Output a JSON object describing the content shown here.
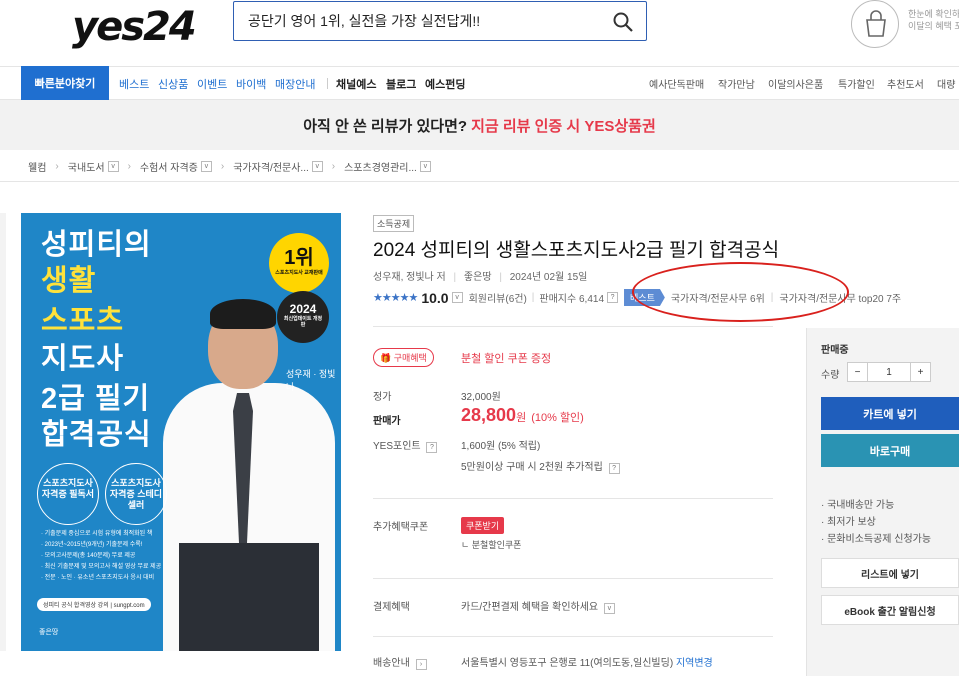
{
  "header": {
    "logo": "yes24",
    "search_value": "공단기 영어 1위, 실전을 가장 실전답게!!",
    "bag_text_1": "한눈에 확인하",
    "bag_text_2": "이달의 혜택 포"
  },
  "gnb": {
    "quick": "빠른분야찾기",
    "left_items": [
      "베스트",
      "신상품",
      "이벤트",
      "바이백",
      "매장안내"
    ],
    "mid_items": [
      "채널예스",
      "블로그",
      "예스펀딩"
    ],
    "right_items": [
      "예사단독판매",
      "작가만남",
      "이달의사은품",
      "특가할인",
      "추천도서",
      "대량"
    ]
  },
  "banner": {
    "text": "아직 안 쓴 리뷰가 있다면?",
    "highlight": "지금 리뷰 인증 시 YES상품권"
  },
  "breadcrumb": [
    "웰컴",
    "국내도서",
    "수험서 자격증",
    "국가자격/전문사...",
    "스포츠경영관리..."
  ],
  "cover": {
    "lines_white_top": "성피티의",
    "lines_yellow": [
      "생활",
      "스포츠",
      "지도사"
    ],
    "lines_white_bottom": [
      "2급 필기",
      "합격공식"
    ],
    "badge_num": "1위",
    "badge_sub": "스포츠지도사 교재판매",
    "badge2_year": "2024",
    "badge2_sub": "최신업데이트 개정판",
    "author": "성우재 · 정빛나",
    "circle1": "스포츠지도사 자격증 필독서",
    "circle2": "스포츠지도사 자격증 스테디셀러",
    "bullets": [
      "· 기출문제 중심으로 시험 유형에 최적화된 책",
      "· 2023년~2015년(9개년) 기출문제 수록!",
      "· 모의고사문제(총 140문제) 무료 제공",
      "· 최신 기출문제 및 모의고사 해설 영상 무료 제공",
      "· 전문 · 노인 · 유소년 스포츠지도사 응시 대비"
    ],
    "url": "성피티 공식 합격영상 강의 | sungpt.com",
    "publisher": "좋은땅"
  },
  "product": {
    "tag": "소득공제",
    "title": "2024 성피티의 생활스포츠지도사2급 필기 합격공식",
    "authors": "성우재, 정빛나 저",
    "publisher": "좋은땅",
    "date": "2024년 02월 15일",
    "score": "10.0",
    "reviews": "회원리뷰(6건)",
    "sales_index": "판매지수 6,414",
    "best_label": "베스트",
    "rank1": "국가자격/전문사무 6위",
    "rank2": "국가자격/전문사무 top20 7주"
  },
  "price": {
    "benefit_tag": "구매혜택",
    "benefit_text": "분철 할인 쿠폰 증정",
    "list_label": "정가",
    "list_value": "32,000원",
    "sale_label": "판매가",
    "sale_value": "28,800",
    "sale_unit": "원",
    "sale_discount": "(10% 할인)",
    "point_label": "YES포인트",
    "point_value": "1,600원 (5% 적립)",
    "point_extra": "5만원이상 구매 시 2천원 추가적립",
    "coupon_label": "추가혜택쿠폰",
    "coupon_badge": "쿠폰받기",
    "coupon_text": "ㄴ 분철할인쿠폰",
    "pay_label": "결제혜택",
    "pay_text": "카드/간편결제 혜택을 확인하세요",
    "ship_label": "배송안내",
    "ship_text": "서울특별시 영등포구 은행로 11(여의도동,일신빌딩)",
    "ship_change": "지역변경"
  },
  "side": {
    "status": "판매중",
    "qty_label": "수량",
    "qty_value": "1",
    "cart": "카트에 넣기",
    "buy": "바로구매",
    "info": [
      "· 국내배송만 가능",
      "· 최저가 보상",
      "· 문화비소득공제 신청가능"
    ],
    "wishlist": "리스트에 넣기",
    "ebook": "eBook 출간 알림신청"
  },
  "colors": {
    "accent": "#1f6fd0",
    "sale": "#e6394a",
    "annotation": "#d9211d"
  }
}
